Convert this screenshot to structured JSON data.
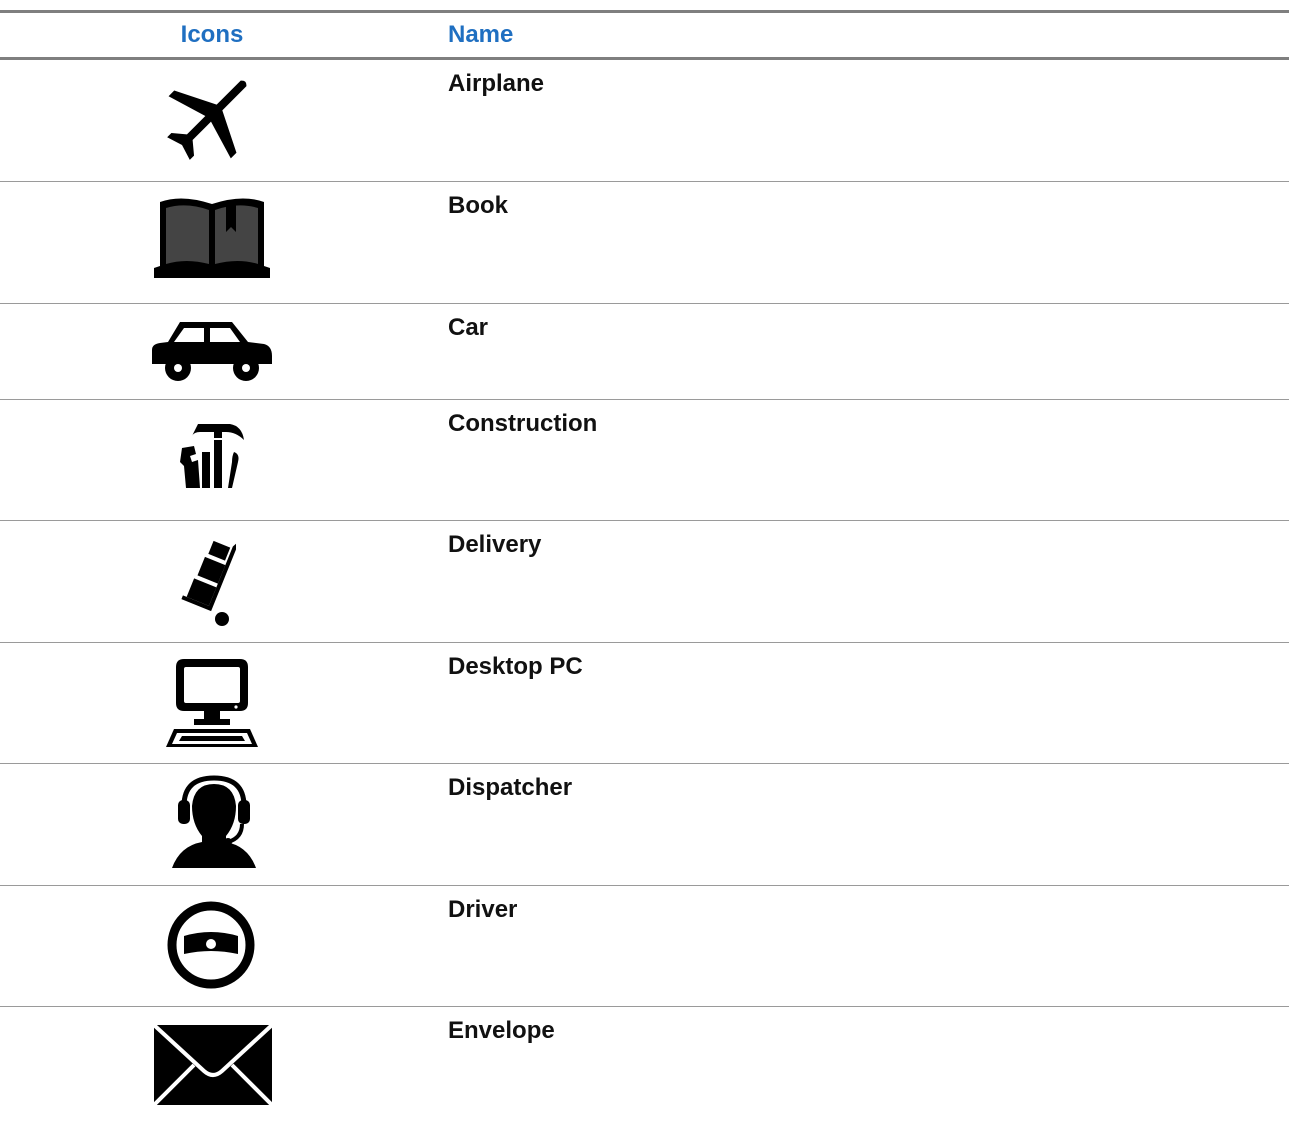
{
  "table": {
    "headers": {
      "icons": "Icons",
      "name": "Name"
    },
    "rows": [
      {
        "name": "Airplane",
        "icon": "airplane-icon"
      },
      {
        "name": "Book",
        "icon": "book-icon"
      },
      {
        "name": "Car",
        "icon": "car-icon"
      },
      {
        "name": "Construction",
        "icon": "construction-icon"
      },
      {
        "name": "Delivery",
        "icon": "delivery-icon"
      },
      {
        "name": "Desktop PC",
        "icon": "desktop-pc-icon"
      },
      {
        "name": "Dispatcher",
        "icon": "dispatcher-icon"
      },
      {
        "name": "Driver",
        "icon": "driver-icon"
      },
      {
        "name": "Envelope",
        "icon": "envelope-icon"
      }
    ]
  },
  "colors": {
    "header_text": "#1f6fc1",
    "body_text": "#111111",
    "rule": "#9a9a9a",
    "header_rule": "#7f7f7f",
    "icon": "#000000"
  }
}
